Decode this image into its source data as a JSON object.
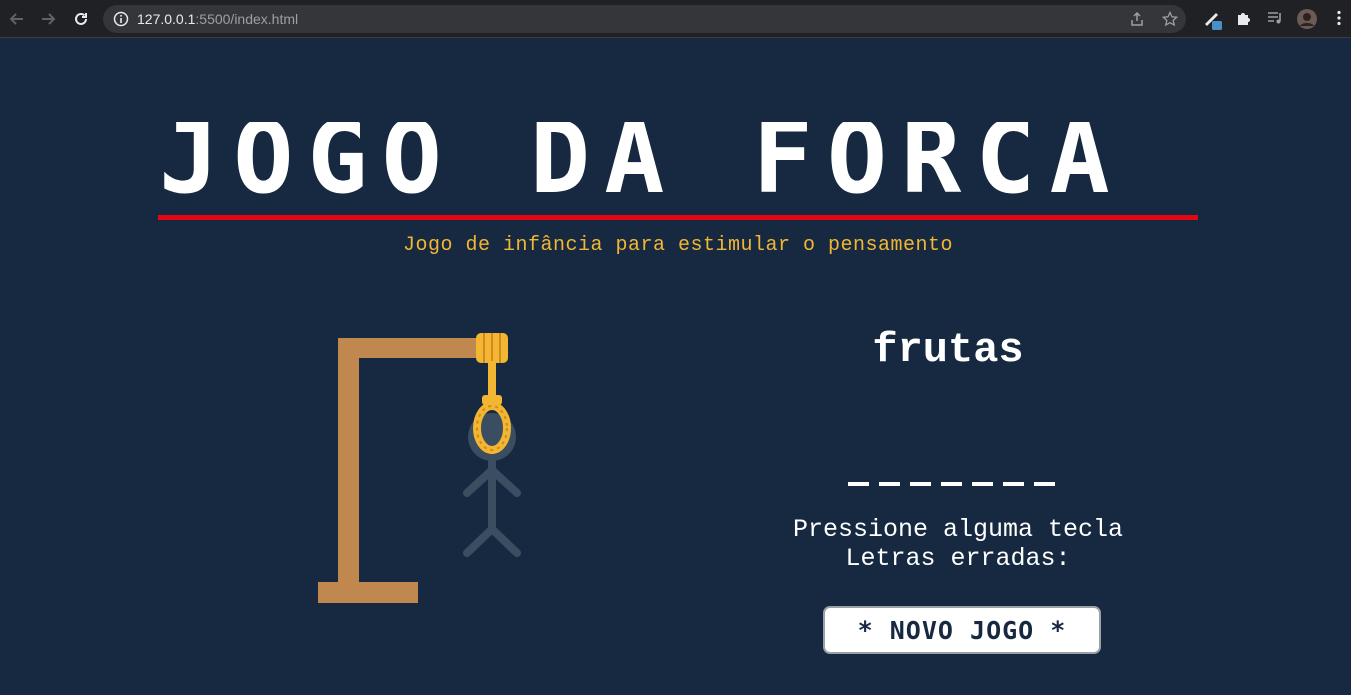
{
  "browser": {
    "url_host": "127.0.0.1",
    "url_path": ":5500/index.html",
    "icons": [
      "back-icon",
      "forward-icon",
      "reload-icon",
      "info-icon",
      "share-icon",
      "bookmark-star-icon",
      "pen-extension-icon",
      "puzzle-extension-icon",
      "media-queue-icon",
      "profile-avatar",
      "more-menu-icon"
    ]
  },
  "page": {
    "title": "JOGO DA FORCA",
    "subtitle": "Jogo de infância para estimular o pensamento",
    "hint": "frutas",
    "slots_count": 7,
    "message": "Pressione alguma tecla",
    "wrong_letters_label": "Letras erradas:",
    "new_game_button": "* NOVO JOGO *"
  },
  "colors": {
    "background": "#162940",
    "title": "#ffffff",
    "underline": "#e30613",
    "subtitle": "#f2b632",
    "gallows": "#c0874f",
    "rope": "#f2b632",
    "stickman": "#3b4d60"
  }
}
